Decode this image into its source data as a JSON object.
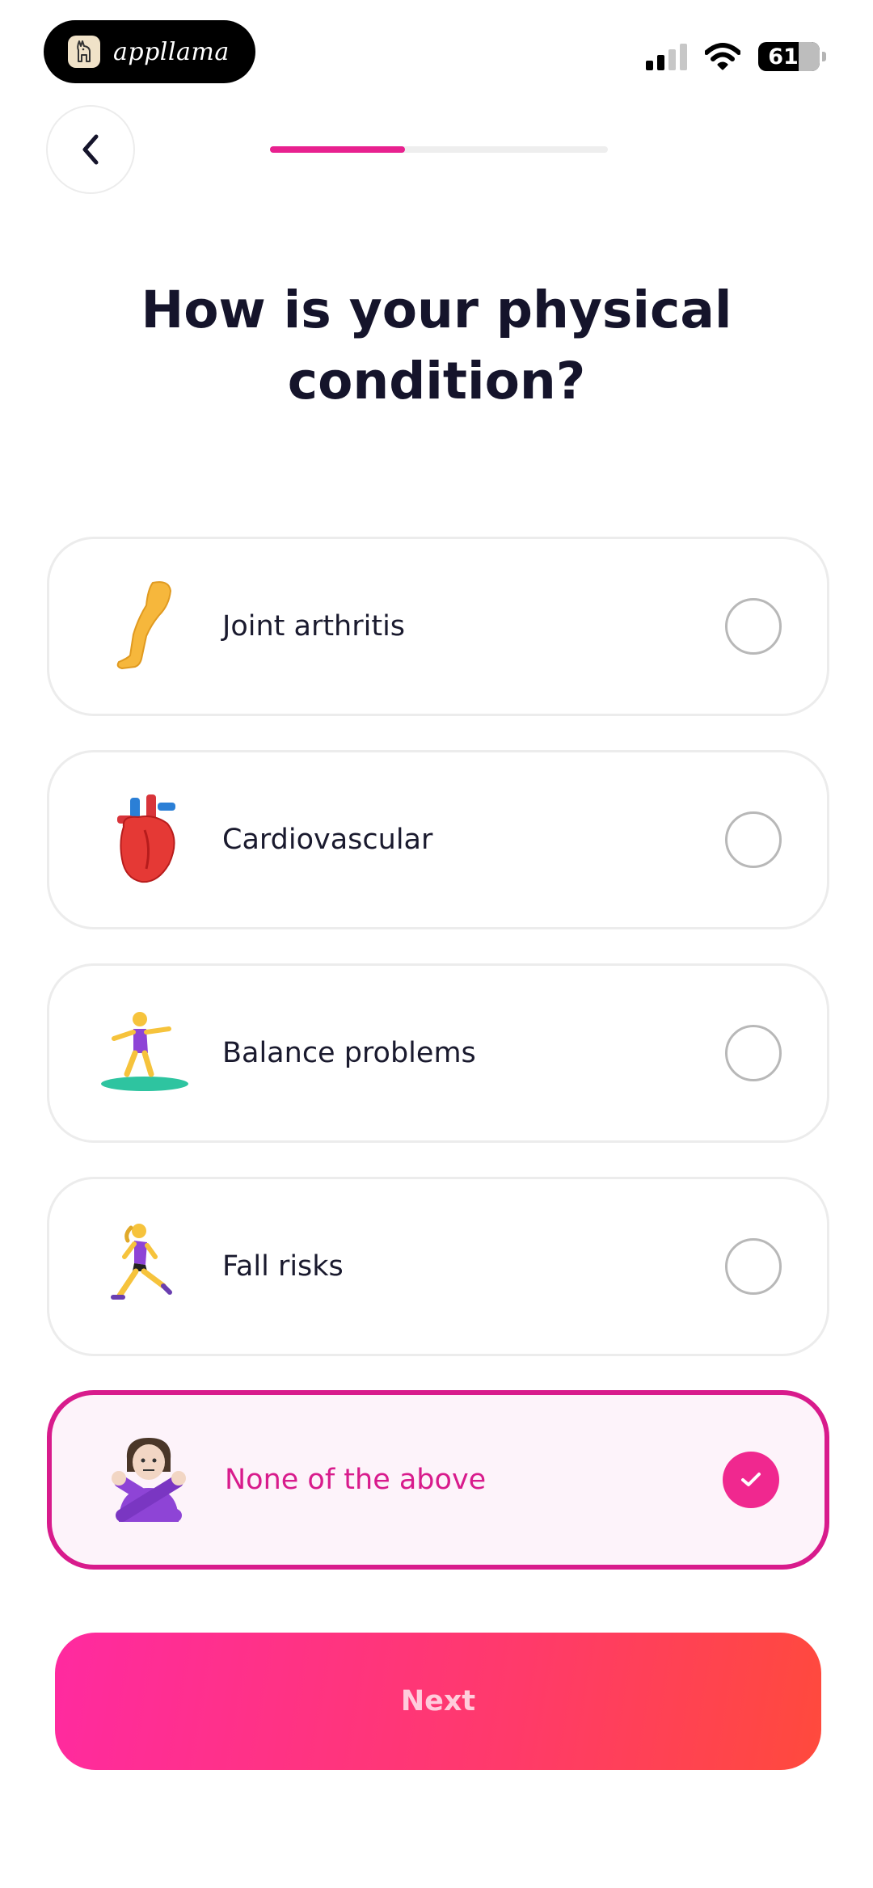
{
  "status_bar": {
    "app_name": "appllama",
    "battery_level": "61",
    "icons": [
      "llama-logo-icon",
      "cellular-signal-icon",
      "wifi-icon",
      "battery-icon"
    ]
  },
  "header": {
    "back_icon": "chevron-left-icon",
    "progress_fraction": 0.4
  },
  "title": "How is your physical condition?",
  "options": [
    {
      "label": "Joint arthritis",
      "icon": "leg-icon",
      "selected": false
    },
    {
      "label": "Cardiovascular",
      "icon": "anatomical-heart-icon",
      "selected": false
    },
    {
      "label": "Balance problems",
      "icon": "surfer-icon",
      "selected": false
    },
    {
      "label": "Fall risks",
      "icon": "running-woman-icon",
      "selected": false
    },
    {
      "label": "None of the above",
      "icon": "no-gesture-icon",
      "selected": true
    }
  ],
  "next_button": {
    "label": "Next"
  },
  "colors": {
    "accent": "#e8218f",
    "selected_border": "#d81b8c",
    "selected_bg": "#fdf3fa",
    "button_gradient_start": "#ff2aa0",
    "button_gradient_end": "#ff4a3c"
  }
}
